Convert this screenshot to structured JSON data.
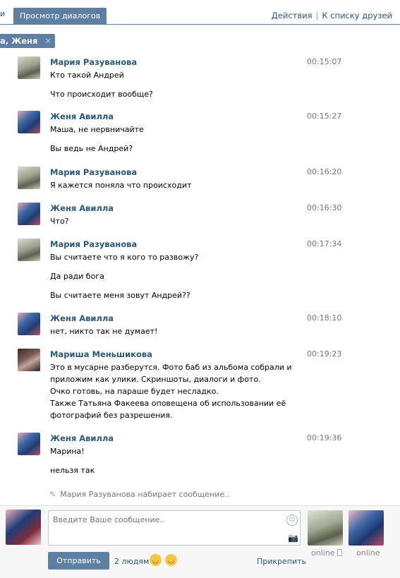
{
  "tabs": {
    "prev_label": "и",
    "active_label": "Просмотр диалогов"
  },
  "actions": {
    "actions_label": "Действия",
    "separator": "|",
    "friends_label": "К списку друзей"
  },
  "chip": {
    "label": "а, Женя"
  },
  "messages": [
    {
      "name": "Мария Разуванова",
      "time": "00:15:07",
      "lines": [
        "Кто такой Андрей",
        "Что происходит вообще?"
      ]
    },
    {
      "name": "Женя Авилла",
      "time": "00:15:27",
      "lines": [
        "Маша, не нервничайте",
        "Вы ведь не Андрей?"
      ]
    },
    {
      "name": "Мария Разуванова",
      "time": "00:16:20",
      "lines": [
        "Я кажется поняла что происходит"
      ]
    },
    {
      "name": "Женя Авилла",
      "time": "00:16:30",
      "lines": [
        "Что?"
      ]
    },
    {
      "name": "Мария Разуванова",
      "time": "00:17:34",
      "lines": [
        "Вы считаете что я кого то развожу?",
        "Да ради бога",
        "Вы считаете меня зовут Андрей??"
      ]
    },
    {
      "name": "Женя Авилла",
      "time": "00:18:10",
      "lines": [
        "нет, никто так не думает!"
      ]
    },
    {
      "name": "Мариша Меньшикова",
      "time": "00:19:23",
      "lines": [
        "Это в мусарне разберутся. Фото баб из альбома собрали и",
        "приложим как улики. Скриншоты, диалоги и фото.",
        "Очко готовь, на параше будет несладко.",
        "Также Татьяна Факеева оповещена об использовании её",
        "фотографий без разрешения."
      ]
    },
    {
      "name": "Женя Авилла",
      "time": "00:19:36",
      "lines": [
        "Марина!",
        "нельзя так"
      ]
    }
  ],
  "typing": {
    "text": "Мария Разуванова набирает сообщение.."
  },
  "composer": {
    "placeholder": "Введите Ваше сообщение.."
  },
  "peers": [
    {
      "status": "online"
    },
    {
      "status": "online"
    }
  ],
  "footer": {
    "send_label": "Отправить",
    "people_label": "2 людям",
    "attach_label": "Прикрепить"
  },
  "icons": {
    "smile": "smile-icon",
    "camera": "camera-icon",
    "pencil": "pencil-icon",
    "close": "close-icon"
  }
}
